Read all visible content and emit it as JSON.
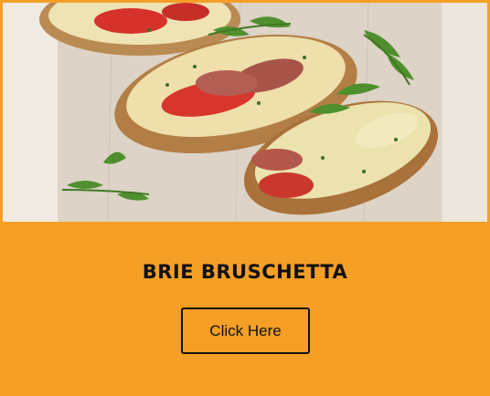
{
  "card": {
    "title": "BRIE BRUSCHETTA",
    "button_label": "Click Here",
    "image_subject": "brie-bruschetta-photo"
  },
  "colors": {
    "background": "#F59F26",
    "text": "#111111",
    "button_border": "#111111"
  }
}
